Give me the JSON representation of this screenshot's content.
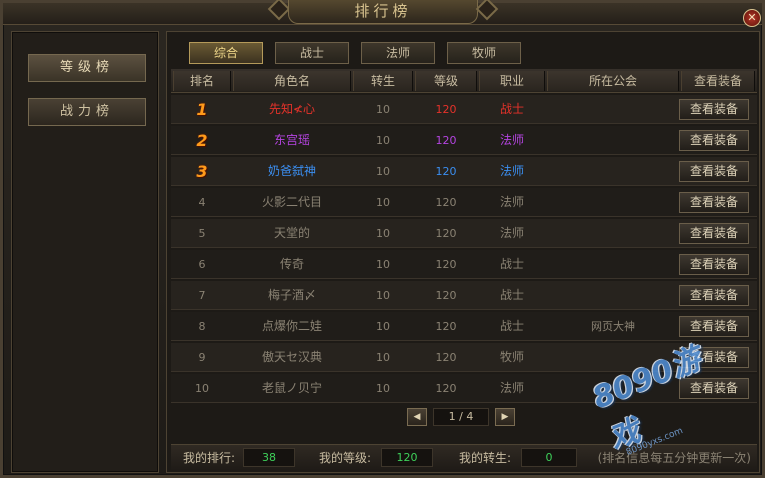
{
  "window": {
    "title": "排行榜",
    "close_glyph": "✕"
  },
  "sidebar": {
    "items": [
      {
        "label": "等级榜",
        "active": true
      },
      {
        "label": "战力榜",
        "active": false
      }
    ]
  },
  "tabs": [
    {
      "label": "综合",
      "active": true
    },
    {
      "label": "战士",
      "active": false
    },
    {
      "label": "法师",
      "active": false
    },
    {
      "label": "牧师",
      "active": false
    }
  ],
  "table": {
    "headers": [
      "排名",
      "角色名",
      "转生",
      "等级",
      "职业",
      "所在公会",
      "查看装备"
    ],
    "button_label": "查看装备",
    "rows": [
      {
        "rank": "1",
        "name": "先知≮心",
        "rebirth": "10",
        "level": "120",
        "job": "战士",
        "guild": "",
        "color": "#e5322a"
      },
      {
        "rank": "2",
        "name": "东宫瑶",
        "rebirth": "10",
        "level": "120",
        "job": "法师",
        "guild": "",
        "color": "#b444e0"
      },
      {
        "rank": "3",
        "name": "奶爸弑神",
        "rebirth": "10",
        "level": "120",
        "job": "法师",
        "guild": "",
        "color": "#3b8ef0"
      },
      {
        "rank": "4",
        "name": "火影二代目",
        "rebirth": "10",
        "level": "120",
        "job": "法师",
        "guild": "",
        "color": ""
      },
      {
        "rank": "5",
        "name": "天堂的",
        "rebirth": "10",
        "level": "120",
        "job": "法师",
        "guild": "",
        "color": ""
      },
      {
        "rank": "6",
        "name": "传奇",
        "rebirth": "10",
        "level": "120",
        "job": "战士",
        "guild": "",
        "color": ""
      },
      {
        "rank": "7",
        "name": "梅子酒〆",
        "rebirth": "10",
        "level": "120",
        "job": "战士",
        "guild": "",
        "color": ""
      },
      {
        "rank": "8",
        "name": "点爆你二娃",
        "rebirth": "10",
        "level": "120",
        "job": "战士",
        "guild": "网页大神",
        "color": ""
      },
      {
        "rank": "9",
        "name": "傲天セ汉典",
        "rebirth": "10",
        "level": "120",
        "job": "牧师",
        "guild": "",
        "color": ""
      },
      {
        "rank": "10",
        "name": "老鼠ノ贝宁",
        "rebirth": "10",
        "level": "120",
        "job": "法师",
        "guild": "",
        "color": ""
      }
    ]
  },
  "pager": {
    "prev_glyph": "◀",
    "next_glyph": "▶",
    "text": "1 / 4"
  },
  "footer": {
    "my_rank_label": "我的排行:",
    "my_rank_value": "38",
    "my_level_label": "我的等级:",
    "my_level_value": "120",
    "my_rebirth_label": "我的转生:",
    "my_rebirth_value": "0",
    "note": "(排名信息每五分钟更新一次)"
  },
  "watermark": {
    "main": "8090游戏",
    "sub": "8090yxs.com"
  },
  "colors": {
    "accent": "#f0d88a",
    "value_green": "#3ed05a",
    "rank_badge": "#ff9a1a"
  }
}
